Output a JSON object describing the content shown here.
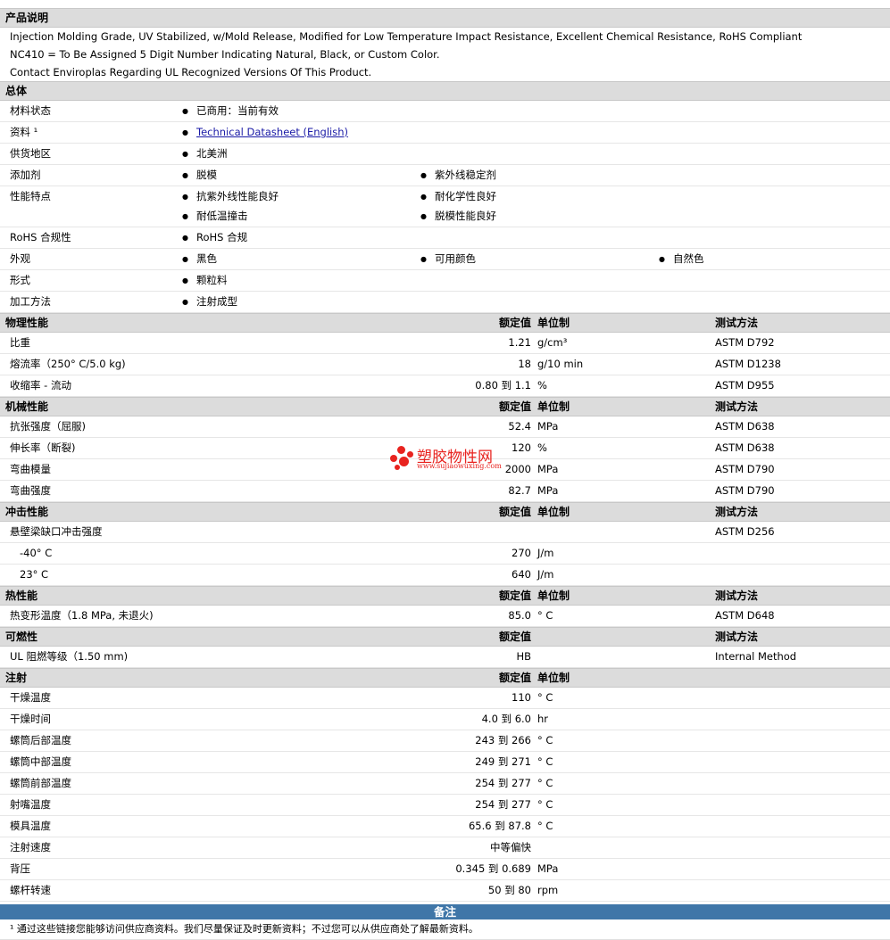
{
  "sections": {
    "description": "产品说明",
    "general": "总体",
    "physical": "物理性能",
    "mechanical": "机械性能",
    "impact": "冲击性能",
    "thermal": "热性能",
    "flammability": "可燃性",
    "injection": "注射",
    "notes": "备注"
  },
  "headers": {
    "nominal": "额定值",
    "unit": "单位制",
    "method": "测试方法"
  },
  "description": [
    "Injection Molding Grade, UV Stabilized, w/Mold Release, Modified for Low Temperature Impact Resistance, Excellent Chemical Resistance, RoHS Compliant",
    "NC410 = To Be Assigned 5 Digit Number Indicating Natural, Black, or Custom Color.",
    "Contact Enviroplas Regarding UL Recognized Versions Of This Product."
  ],
  "general": {
    "status_label": "材料状态",
    "status": "已商用：当前有效",
    "docs_label": "资料 ¹",
    "docs_link": "Technical Datasheet (English)",
    "region_label": "供货地区",
    "region": "北美洲",
    "additive_label": "添加剂",
    "additive_1": "脱模",
    "additive_2": "紫外线稳定剂",
    "features_label": "性能特点",
    "feature_1": "抗紫外线性能良好",
    "feature_2": "耐化学性良好",
    "feature_3": "耐低温撞击",
    "feature_4": "脱模性能良好",
    "rohs_label": "RoHS 合规性",
    "rohs": "RoHS 合规",
    "appearance_label": "外观",
    "appearance_1": "黑色",
    "appearance_2": "可用颜色",
    "appearance_3": "自然色",
    "form_label": "形式",
    "form": "颗粒料",
    "process_label": "加工方法",
    "process": "注射成型"
  },
  "physical": [
    {
      "label": "比重",
      "value": "1.21",
      "unit": "g/cm³",
      "method": "ASTM D792"
    },
    {
      "label": "熔流率（250°  C/5.0 kg)",
      "value": "18",
      "unit": "g/10 min",
      "method": "ASTM D1238"
    },
    {
      "label": "收缩率  - 流动",
      "value": "0.80 到  1.1",
      "unit": "%",
      "method": "ASTM D955"
    }
  ],
  "mechanical": [
    {
      "label": "抗张强度（屈服)",
      "value": "52.4",
      "unit": "MPa",
      "method": "ASTM D638"
    },
    {
      "label": "伸长率（断裂)",
      "value": "120",
      "unit": "%",
      "method": "ASTM D638"
    },
    {
      "label": "弯曲模量",
      "value": "2000",
      "unit": "MPa",
      "method": "ASTM D790"
    },
    {
      "label": "弯曲强度",
      "value": "82.7",
      "unit": "MPa",
      "method": "ASTM D790"
    }
  ],
  "impact": [
    {
      "label": "悬壁梁缺口冲击强度",
      "value": "",
      "unit": "",
      "method": "ASTM D256"
    },
    {
      "label": "-40°  C",
      "value": "270",
      "unit": "J/m",
      "method": ""
    },
    {
      "label": "23°  C",
      "value": "640",
      "unit": "J/m",
      "method": ""
    }
  ],
  "thermal": [
    {
      "label": "热变形温度（1.8 MPa, 未退火)",
      "value": "85.0",
      "unit": "°  C",
      "method": "ASTM D648"
    }
  ],
  "flammability": [
    {
      "label": "UL 阻燃等级（1.50 mm)",
      "value": "HB",
      "unit": "",
      "method": "Internal Method"
    }
  ],
  "injection": [
    {
      "label": "干燥温度",
      "value": "110",
      "unit": "°  C"
    },
    {
      "label": "干燥时间",
      "value": "4.0 到  6.0",
      "unit": "hr"
    },
    {
      "label": "螺筒后部温度",
      "value": "243 到  266",
      "unit": "°  C"
    },
    {
      "label": "螺筒中部温度",
      "value": "249 到  271",
      "unit": "°  C"
    },
    {
      "label": "螺筒前部温度",
      "value": "254 到  277",
      "unit": "°  C"
    },
    {
      "label": "射嘴温度",
      "value": "254 到  277",
      "unit": "°  C"
    },
    {
      "label": "模具温度",
      "value": "65.6 到  87.8",
      "unit": "°  C"
    },
    {
      "label": "注射速度",
      "value": "中等偏快",
      "unit": ""
    },
    {
      "label": "背压",
      "value": "0.345 到  0.689",
      "unit": "MPa"
    },
    {
      "label": "螺杆转速",
      "value": "50 到  80",
      "unit": "rpm"
    }
  ],
  "footnote": "¹ 通过这些链接您能够访问供应商资料。我们尽量保证及时更新资料；不过您可以从供应商处了解最新资料。",
  "watermark": {
    "name": "塑胶物性网",
    "url": "www.sujiaowuxing.com"
  }
}
